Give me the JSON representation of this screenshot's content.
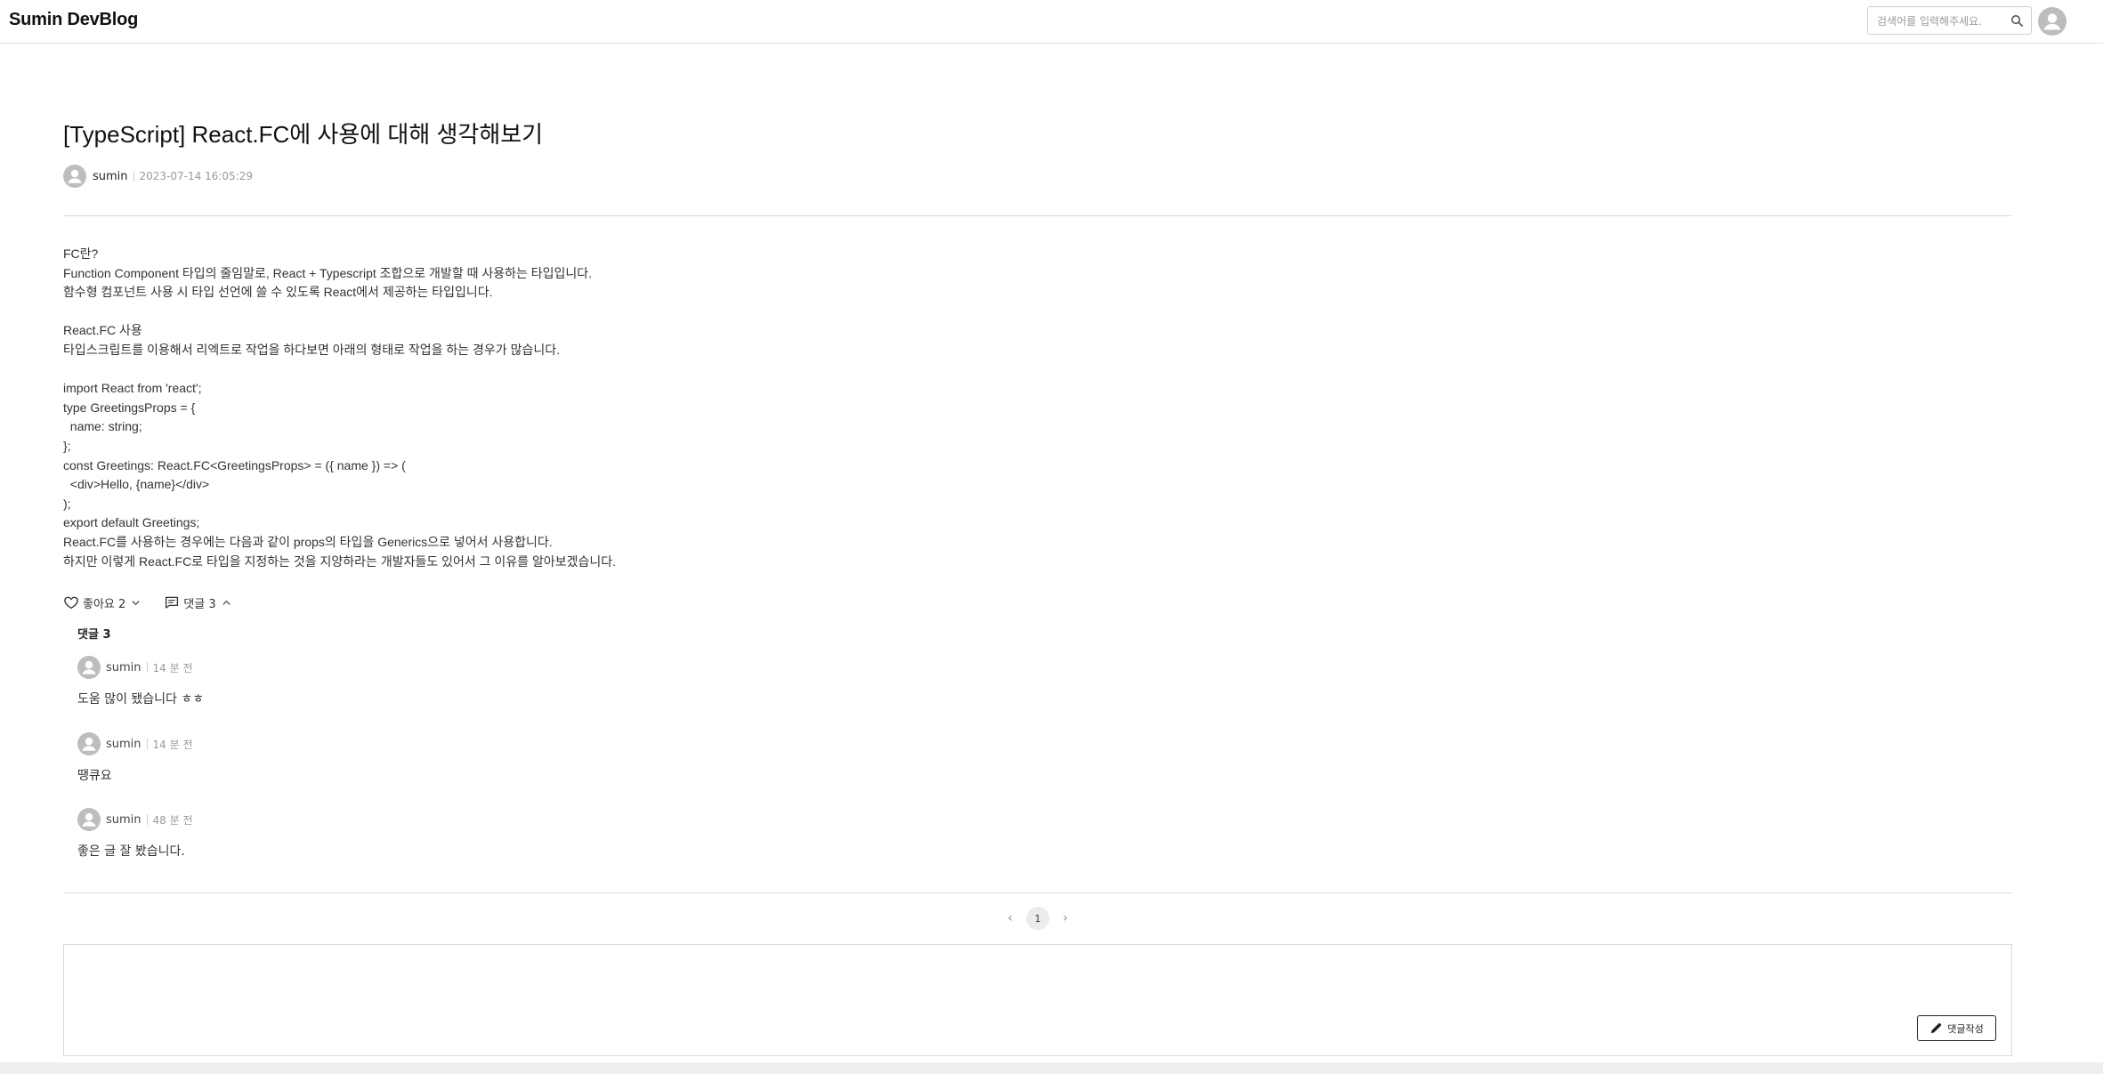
{
  "header": {
    "brand": "Sumin DevBlog",
    "search_placeholder": "검색어를 입력해주세요."
  },
  "post": {
    "title": "[TypeScript] React.FC에 사용에 대해 생각해보기",
    "author": "sumin",
    "date": "2023-07-14 16:05:29",
    "content_lines": [
      "FC란?",
      "Function Component 타입의 줄임말로, React + Typescript 조합으로 개발할 때 사용하는 타입입니다.",
      "함수형 컴포넌트 사용 시 타입 선언에 쓸 수 있도록 React에서 제공하는 타입입니다.",
      "",
      "React.FC 사용",
      "타입스크립트를 이용해서 리엑트로 작업을 하다보면 아래의 형태로 작업을 하는 경우가 많습니다.",
      "",
      "import React from 'react';",
      "type GreetingsProps = {",
      "  name: string;",
      "};",
      "const Greetings: React.FC<GreetingsProps> = ({ name }) => (",
      "  <div>Hello, {name}</div>",
      ");",
      "export default Greetings;",
      "React.FC를 사용하는 경우에는 다음과 같이 props의 타입을 Generics으로 넣어서 사용합니다.",
      "하지만 이렇게 React.FC로 타입을 지정하는 것을 지양하라는 개발자들도 있어서 그 이유를 알아보겠습니다."
    ]
  },
  "actions": {
    "like_label": "좋아요 2",
    "comment_label": "댓글 3"
  },
  "comments": {
    "heading": "댓글 3",
    "items": [
      {
        "author": "sumin",
        "time": "14 분 전",
        "text": "도움 많이 됐습니다 ㅎㅎ"
      },
      {
        "author": "sumin",
        "time": "14 분 전",
        "text": "땡큐요"
      },
      {
        "author": "sumin",
        "time": "48 분 전",
        "text": "좋은 글 잘 봤습니다."
      }
    ]
  },
  "pagination": {
    "current_page": "1"
  },
  "editor": {
    "submit_label": "댓글작성"
  },
  "icons": {
    "search": "search-icon",
    "avatar": "user-avatar-icon",
    "like": "heart-icon",
    "comment": "comment-icon",
    "pen": "pen-icon"
  }
}
